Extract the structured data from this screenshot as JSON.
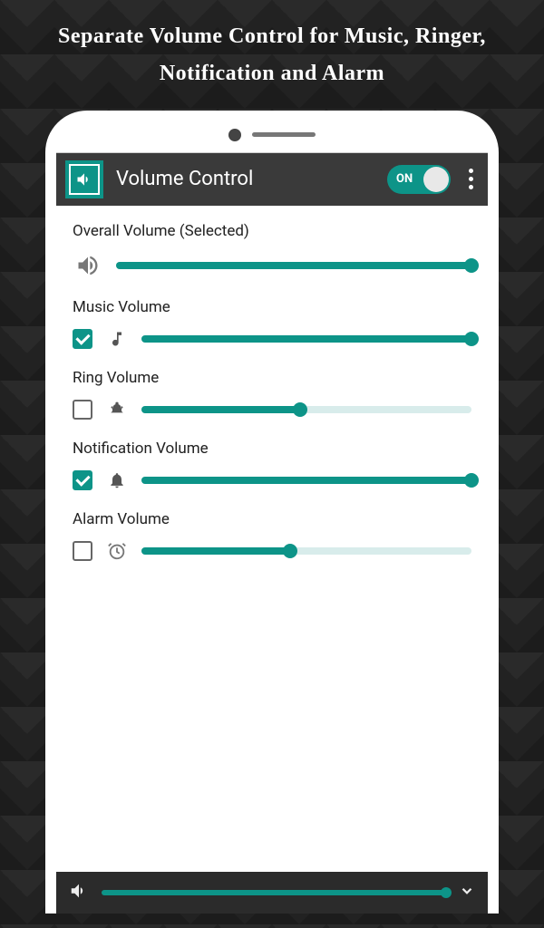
{
  "promo": "Separate Volume Control for Music, Ringer, Notification and Alarm",
  "appbar": {
    "title": "Volume Control",
    "toggle_label": "ON",
    "toggle_on": true
  },
  "sections": {
    "overall": {
      "label": "Overall Volume (Selected)",
      "value": 100
    },
    "music": {
      "label": "Music Volume",
      "checked": true,
      "value": 100
    },
    "ring": {
      "label": "Ring Volume",
      "checked": false,
      "value": 48
    },
    "notif": {
      "label": "Notification Volume",
      "checked": true,
      "value": 100
    },
    "alarm": {
      "label": "Alarm Volume",
      "checked": false,
      "value": 45
    }
  },
  "bottom": {
    "value": 100
  },
  "colors": {
    "accent": "#0d9488",
    "appbar": "#3a3a3a"
  }
}
